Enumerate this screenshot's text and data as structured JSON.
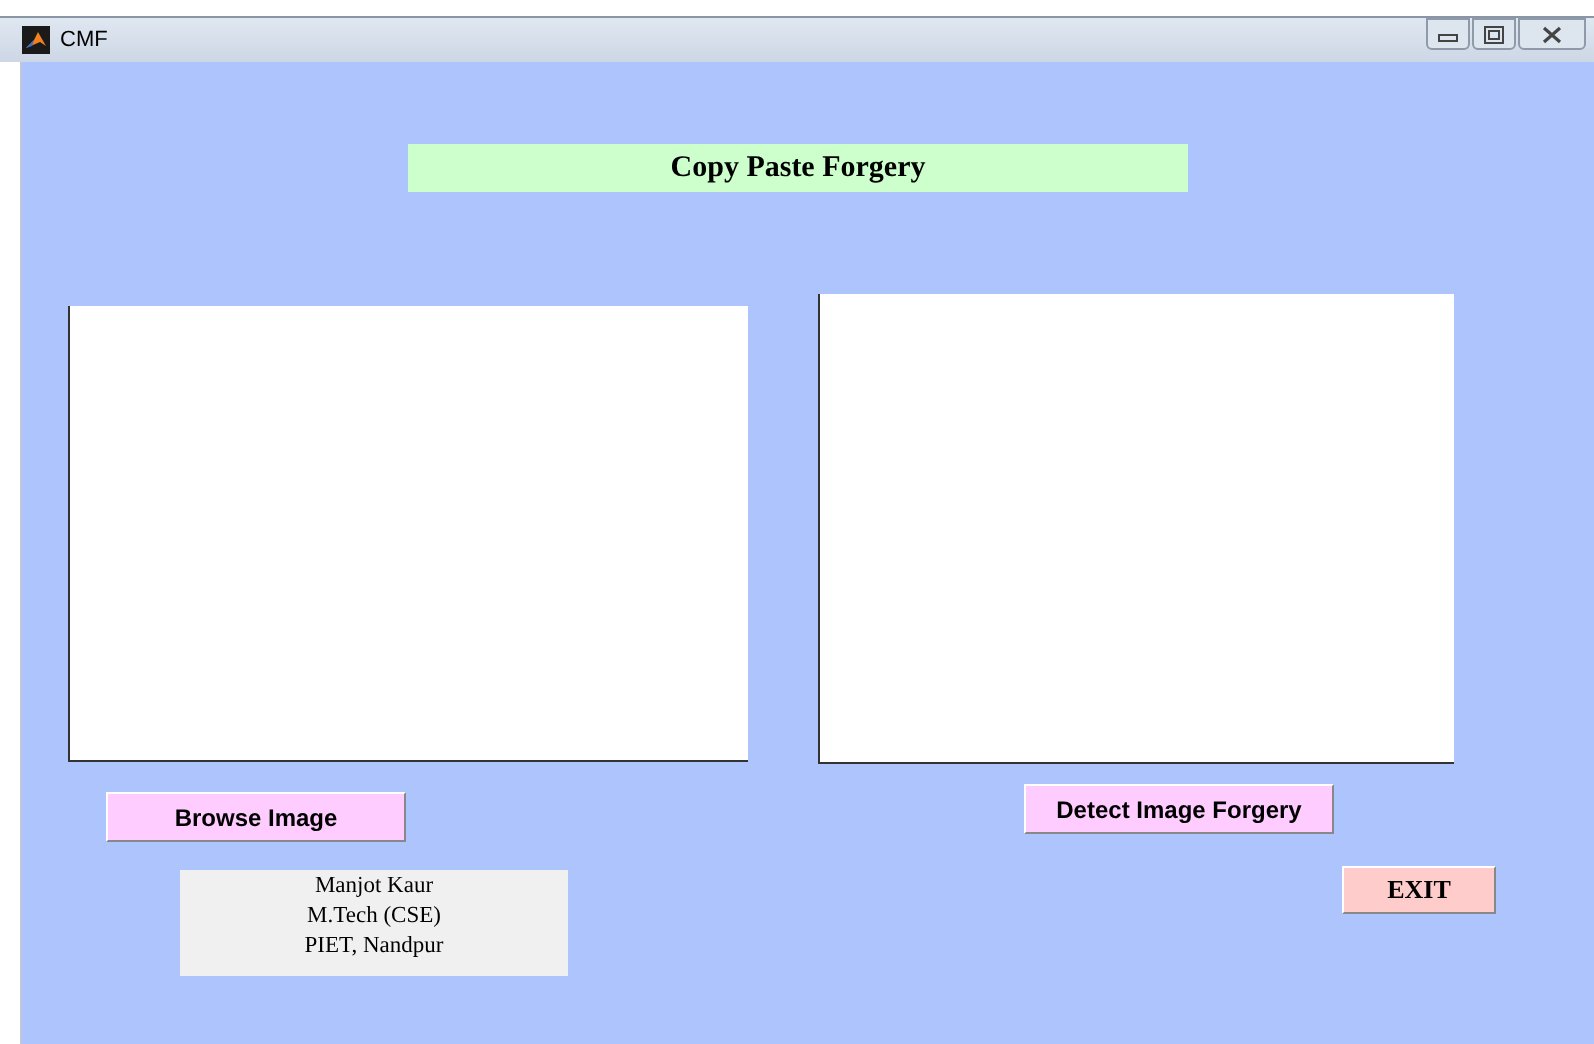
{
  "window": {
    "title": "CMF"
  },
  "heading": "Copy Paste Forgery",
  "buttons": [
    {
      "kind": "browse",
      "label": "Browse Image"
    },
    {
      "kind": "detect",
      "label": "Detect Image Forgery"
    },
    {
      "kind": "exit",
      "label": "EXIT"
    }
  ],
  "author_info": [
    "Manjot Kaur",
    "M.Tech (CSE)",
    "PIET, Nandpur"
  ]
}
